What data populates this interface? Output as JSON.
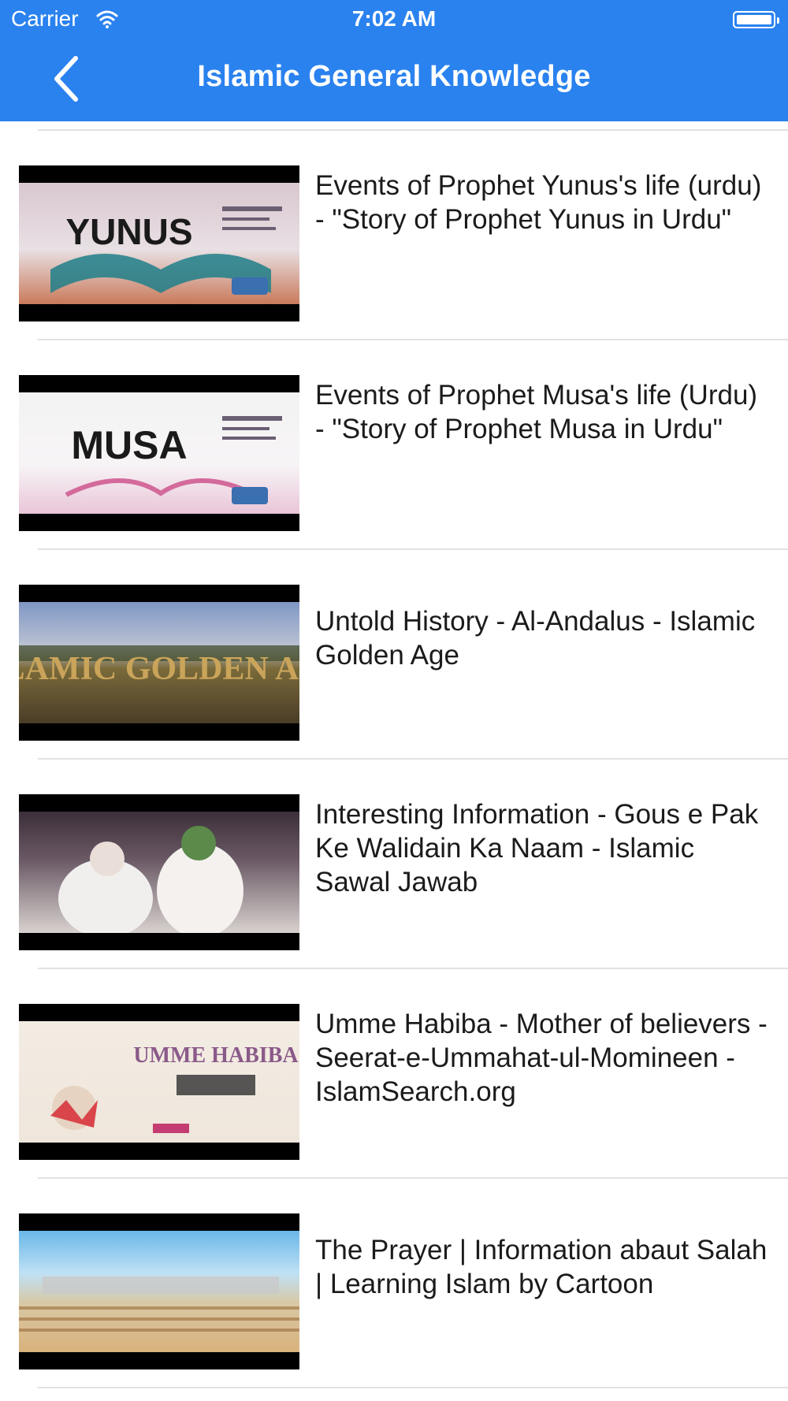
{
  "status_bar": {
    "carrier": "Carrier",
    "time": "7:02 AM"
  },
  "nav": {
    "title": "Islamic General Knowledge",
    "back_icon": "chevron-left-icon"
  },
  "colors": {
    "nav_background": "#2a82ef",
    "text": "#1b1b1b",
    "separator": "#e2e2e2"
  },
  "videos": [
    {
      "title": "Events of Prophet Yunus's life (urdu) -  \"Story of Prophet Yunus in Urdu\"",
      "thumb_caption": "YUNUS"
    },
    {
      "title": "Events of Prophet Musa's life (Urdu) -  \"Story of Prophet Musa in Urdu\"",
      "thumb_caption": "MUSA"
    },
    {
      "title": "Untold History - Al-Andalus - Islamic Golden Age",
      "thumb_caption": "ISLAMIC GOLDEN AGE"
    },
    {
      "title": "Interesting Information - Gous e Pak Ke Walidain Ka Naam - Islamic Sawal Jawab",
      "thumb_caption": ""
    },
    {
      "title": "Umme Habiba - Mother of believers - Seerat-e-Ummahat-ul-Momineen - IslamSearch.org",
      "thumb_caption": "UMME HABIBA"
    },
    {
      "title": "The Prayer | Information abaut Salah | Learning Islam by Cartoon",
      "thumb_caption": ""
    }
  ]
}
